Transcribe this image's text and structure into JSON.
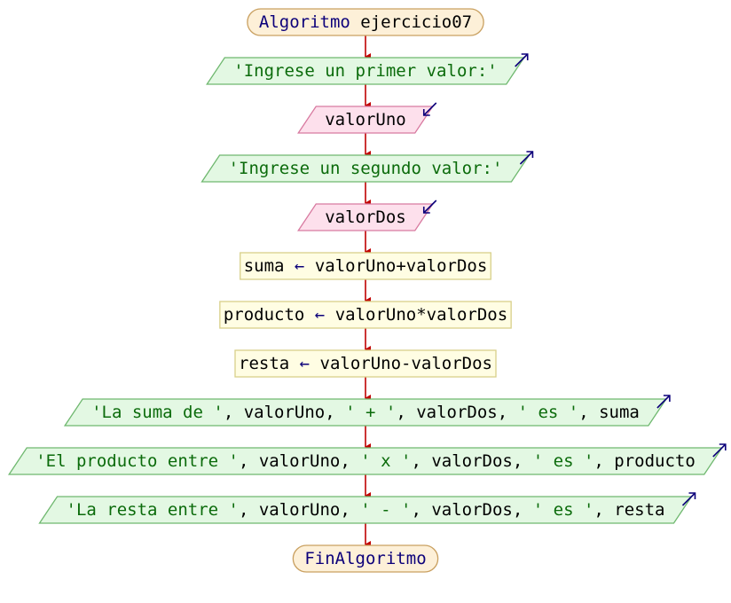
{
  "colors": {
    "terminal_fill": "#fdf0d8",
    "terminal_stroke": "#c9a060",
    "output_fill": "#e3f8e3",
    "output_stroke": "#6fb86f",
    "input_fill": "#fde0ec",
    "input_stroke": "#d87aa0",
    "process_fill": "#fffde3",
    "process_stroke": "#d8d08a",
    "arrow": "#c00000",
    "io_arrow": "#0c007a",
    "keyword": "#0c007a",
    "string": "#0b6b0b",
    "variable": "#000000"
  },
  "nodes": [
    {
      "id": "start",
      "kind": "terminal",
      "name": "start-terminal",
      "parts": [
        [
          "kw",
          "Algoritmo"
        ],
        [
          "var",
          " ejercicio07"
        ]
      ]
    },
    {
      "id": "out1",
      "kind": "output",
      "name": "output-prompt-first-value",
      "parts": [
        [
          "str",
          "'Ingrese un primer valor:'"
        ]
      ]
    },
    {
      "id": "in1",
      "kind": "input",
      "name": "input-valorUno",
      "parts": [
        [
          "var",
          "valorUno"
        ]
      ]
    },
    {
      "id": "out2",
      "kind": "output",
      "name": "output-prompt-second-value",
      "parts": [
        [
          "str",
          "'Ingrese un segundo valor:'"
        ]
      ]
    },
    {
      "id": "in2",
      "kind": "input",
      "name": "input-valorDos",
      "parts": [
        [
          "var",
          "valorDos"
        ]
      ]
    },
    {
      "id": "p1",
      "kind": "process",
      "name": "process-suma",
      "parts": [
        [
          "var",
          "suma "
        ],
        [
          "op",
          "←"
        ],
        [
          "var",
          " valorUno+valorDos"
        ]
      ]
    },
    {
      "id": "p2",
      "kind": "process",
      "name": "process-producto",
      "parts": [
        [
          "var",
          "producto "
        ],
        [
          "op",
          "←"
        ],
        [
          "var",
          " valorUno*valorDos"
        ]
      ]
    },
    {
      "id": "p3",
      "kind": "process",
      "name": "process-resta",
      "parts": [
        [
          "var",
          "resta "
        ],
        [
          "op",
          "←"
        ],
        [
          "var",
          " valorUno-valorDos"
        ]
      ]
    },
    {
      "id": "out3",
      "kind": "output",
      "name": "output-suma",
      "parts": [
        [
          "str",
          "'La suma de '"
        ],
        [
          "var",
          ", valorUno, "
        ],
        [
          "str",
          "' + '"
        ],
        [
          "var",
          ", valorDos, "
        ],
        [
          "str",
          "' es '"
        ],
        [
          "var",
          ", suma"
        ]
      ]
    },
    {
      "id": "out4",
      "kind": "output",
      "name": "output-producto",
      "parts": [
        [
          "str",
          "'El producto entre '"
        ],
        [
          "var",
          ", valorUno, "
        ],
        [
          "str",
          "' x '"
        ],
        [
          "var",
          ", valorDos, "
        ],
        [
          "str",
          "' es '"
        ],
        [
          "var",
          ", producto"
        ]
      ]
    },
    {
      "id": "out5",
      "kind": "output",
      "name": "output-resta",
      "parts": [
        [
          "str",
          "'La resta entre '"
        ],
        [
          "var",
          ", valorUno, "
        ],
        [
          "str",
          "' - '"
        ],
        [
          "var",
          ", valorDos, "
        ],
        [
          "str",
          "' es '"
        ],
        [
          "var",
          ", resta"
        ]
      ]
    },
    {
      "id": "end",
      "kind": "terminal",
      "name": "end-terminal",
      "parts": [
        [
          "kw",
          "FinAlgoritmo"
        ]
      ]
    }
  ]
}
